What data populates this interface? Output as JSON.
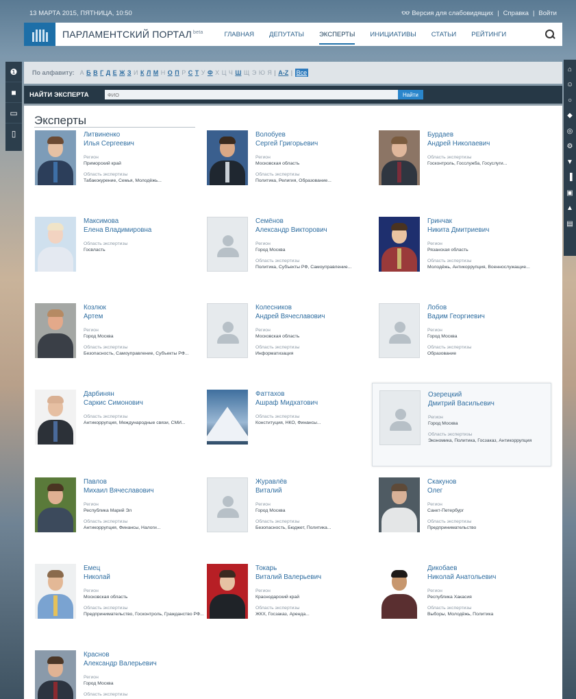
{
  "topbar": {
    "datetime": "13 МАРТА 2015, ПЯТНИЦА, 10:50",
    "accessibility_icon": "glasses-icon",
    "accessibility": "Версия для слабовидящих",
    "sep1": "|",
    "help": "Справка",
    "sep2": "|",
    "login": "Войти"
  },
  "header": {
    "brand": "ПАРЛАМЕНТСКИЙ ПОРТАЛ",
    "beta": "beta",
    "nav": [
      "ГЛАВНАЯ",
      "ДЕПУТАТЫ",
      "ЭКСПЕРТЫ",
      "ИНИЦИАТИВЫ",
      "СТАТЬИ",
      "РЕЙТИНГИ"
    ],
    "active_nav": "ЭКСПЕРТЫ"
  },
  "alphabet": {
    "label": "По алфавиту:",
    "letters": [
      {
        "ch": "А",
        "on": false
      },
      {
        "ch": "Б",
        "on": true
      },
      {
        "ch": "В",
        "on": true
      },
      {
        "ch": "Г",
        "on": true
      },
      {
        "ch": "Д",
        "on": true
      },
      {
        "ch": "Е",
        "on": true
      },
      {
        "ch": "Ж",
        "on": true
      },
      {
        "ch": "З",
        "on": true
      },
      {
        "ch": "И",
        "on": false
      },
      {
        "ch": "К",
        "on": true
      },
      {
        "ch": "Л",
        "on": true
      },
      {
        "ch": "М",
        "on": true
      },
      {
        "ch": "Н",
        "on": false
      },
      {
        "ch": "О",
        "on": true
      },
      {
        "ch": "П",
        "on": true
      },
      {
        "ch": "Р",
        "on": false
      },
      {
        "ch": "С",
        "on": true
      },
      {
        "ch": "Т",
        "on": true
      },
      {
        "ch": "У",
        "on": false
      },
      {
        "ch": "Ф",
        "on": true
      },
      {
        "ch": "Х",
        "on": false
      },
      {
        "ch": "Ц",
        "on": false
      },
      {
        "ch": "Ч",
        "on": false
      },
      {
        "ch": "Ш",
        "on": true
      },
      {
        "ch": "Щ",
        "on": false
      },
      {
        "ch": "Э",
        "on": false
      },
      {
        "ch": "Ю",
        "on": false
      },
      {
        "ch": "Я",
        "on": false
      }
    ],
    "sep": "|",
    "az": "A-Z",
    "all": "Все"
  },
  "find": {
    "label": "НАЙТИ ЭКСПЕРТА",
    "placeholder": "ФИО",
    "button": "Найти"
  },
  "section_title": "Эксперты",
  "labels": {
    "region": "Регион",
    "area": "Область экспертизы"
  },
  "left_icons": [
    "alert-icon",
    "video-icon",
    "book-icon",
    "mobile-icon"
  ],
  "right_icons": [
    "parliament-icon",
    "people-icon",
    "location-icon",
    "tags-icon",
    "globe-icon",
    "settings-icon",
    "shield-icon",
    "chart-icon",
    "briefcase-icon",
    "tree-icon",
    "comment-icon"
  ],
  "experts": [
    {
      "surname": "Литвиненко",
      "given": "Илья Сергеевич",
      "region": "Приморский край",
      "area": "Табакокурение, Семья, Молодёжь...",
      "photo": "real",
      "bg": "#7d9cb8",
      "skin": "#e6c1a4",
      "hair": "#6b4a33",
      "suit": "#2c3e5a",
      "tie": "#3e6fa6"
    },
    {
      "surname": "Волобуев",
      "given": "Сергей Григорьевич",
      "region": "Московская область",
      "area": "Политика, Религия, Образование...",
      "photo": "real",
      "bg": "#3a5f8e",
      "skin": "#d9a886",
      "hair": "#3a2a1e",
      "suit": "#1f2730",
      "tie": "#c9d0d6"
    },
    {
      "surname": "Бурдаев",
      "given": "Андрей Николаевич",
      "region": null,
      "area": "Госконтроль, Госслужба, Госуслуги...",
      "photo": "real",
      "bg": "#8c7565",
      "skin": "#e0b79b",
      "hair": "#7a5b3e",
      "suit": "#2f3640",
      "tie": "#7b2d3a"
    },
    {
      "surname": "Максимова",
      "given": "Елена Владимировна",
      "region": null,
      "area": "Госвласть",
      "photo": "real",
      "bg": "#cfe0ee",
      "skin": "#f2d3c1",
      "hair": "#f0e4c8",
      "suit": "#e4e9f1",
      "tie": "#e4e9f1"
    },
    {
      "surname": "Семёнов",
      "given": "Александр Викторович",
      "region": "Город Москва",
      "area": "Политика, Субъекты РФ, Самоуправление...",
      "photo": "empty"
    },
    {
      "surname": "Гринчак",
      "given": "Никита Дмитриевич",
      "region": "Рязанская область",
      "area": "Молодёжь, Антикоррупция, Военнослужащие...",
      "photo": "real",
      "bg": "#1e2f6e",
      "skin": "#e9c3a2",
      "hair": "#4a3320",
      "suit": "#9a3a3a",
      "tie": "#c9b56e"
    },
    {
      "surname": "Козлюк",
      "given": "Артем",
      "region": "Город Москва",
      "area": "Безопасность, Самоуправление, Субъекты РФ...",
      "photo": "real",
      "bg": "#a4a7a4",
      "skin": "#e3a98a",
      "hair": "#b68a63",
      "suit": "#3a3f47",
      "tie": "#3a3f47"
    },
    {
      "surname": "Колесников",
      "given": "Андрей Вячеславович",
      "region": "Московская область",
      "area": "Информатизация",
      "photo": "empty"
    },
    {
      "surname": "Лобов",
      "given": "Вадим Георгиевич",
      "region": "Город Москва",
      "area": "Образование",
      "photo": "empty"
    },
    {
      "surname": "Дарбинян",
      "given": "Саркис Симонович",
      "region": null,
      "area": "Антикоррупция, Международные связи, СМИ...",
      "photo": "real",
      "bg": "#f2f2f2",
      "skin": "#e6bfa2",
      "hair": "#d9b093",
      "suit": "#2c3138",
      "tie": "#4a6a9a"
    },
    {
      "surname": "Фаттахов",
      "given": "Ашраф Мидхатович",
      "region": null,
      "area": "Конституция, НКО, Финансы...",
      "photo": "mountain",
      "bg": "#3f6f9e"
    },
    {
      "surname": "Озерецкий",
      "given": "Дмитрий Васильевич",
      "region": "Город Москва",
      "area": "Экономика, Политика, Госзаказ, Антикоррупция",
      "photo": "empty",
      "highlight": true
    },
    {
      "surname": "Павлов",
      "given": "Михаил Вячеславович",
      "region": "Республика Марий Эл",
      "area": "Антикоррупция, Финансы, Налоги...",
      "photo": "real",
      "bg": "#5a7a3a",
      "skin": "#e0b092",
      "hair": "#4a3522",
      "suit": "#3c4a5c",
      "tie": "#3c4a5c"
    },
    {
      "surname": "Журавлёв",
      "given": "Виталий",
      "region": "Город Москва",
      "area": "Безопасность, Бюджет, Политика...",
      "photo": "empty"
    },
    {
      "surname": "Скакунов",
      "given": "Олег",
      "region": "Санкт-Петербург",
      "area": "Предпринимательство",
      "photo": "real",
      "bg": "#4f5b63",
      "skin": "#d8b197",
      "hair": "#5e4a38",
      "suit": "#e4e6e7",
      "tie": "#e4e6e7"
    },
    {
      "surname": "Емец",
      "given": "Николай",
      "region": "Московская область",
      "area": "Предпринимательство, Госконтроль, Гражданство РФ...",
      "photo": "real",
      "bg": "#eef0f1",
      "skin": "#e3b896",
      "hair": "#8a6a4c",
      "suit": "#7aa3d1",
      "tie": "#e6c15a"
    },
    {
      "surname": "Токарь",
      "given": "Виталий Валерьевич",
      "region": "Краснодарский край",
      "area": "ЖКХ, Госзаказ, Аренда...",
      "photo": "real",
      "bg": "#b71f25",
      "skin": "#e6c2a3",
      "hair": "#3a2a20",
      "suit": "#1f2328",
      "tie": "#1f2328"
    },
    {
      "surname": "Дикобаев",
      "given": "Николай Анатольевич",
      "region": "Республика Хакасия",
      "area": "Выборы, Молодёжь, Политика",
      "photo": "real",
      "bg": "#ffffff",
      "skin": "#c7976e",
      "hair": "#1d1a18",
      "suit": "#5a2f30",
      "tie": "#5a2f30"
    },
    {
      "surname": "Краснов",
      "given": "Александр Валерьевич",
      "region": "Город Москва",
      "area": "",
      "photo": "real",
      "bg": "#8a9aaa",
      "skin": "#e0b394",
      "hair": "#4b3727",
      "suit": "#2c3440",
      "tie": "#8a2a30"
    }
  ]
}
